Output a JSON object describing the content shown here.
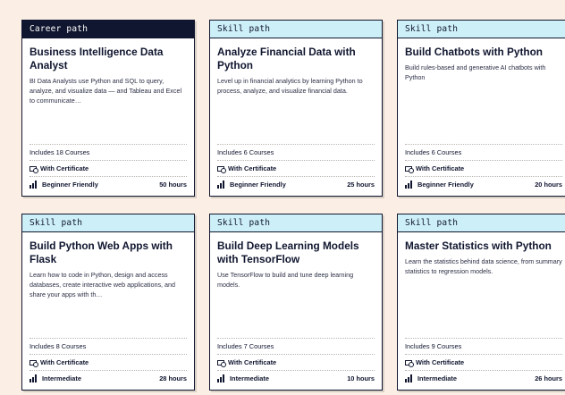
{
  "colors": {
    "page_background": "#fbeee4",
    "career_tag_bg": "#10162f",
    "skill_tag_bg": "#cdeff8",
    "ink": "#10162f"
  },
  "cards": [
    {
      "tag": "Career path",
      "tag_type": "career",
      "title": "Business Intelligence Data Analyst",
      "description": "BI Data Analysts use Python and SQL to query, analyze, and visualize data — and Tableau and Excel to communicate…",
      "courses": "Includes 18 Courses",
      "certificate": "With Certificate",
      "level": "Beginner Friendly",
      "hours": "50 hours"
    },
    {
      "tag": "Skill path",
      "tag_type": "skill",
      "title": "Analyze Financial Data with Python",
      "description": "Level up in financial analytics by learning Python to process, analyze, and visualize financial data.",
      "courses": "Includes 6 Courses",
      "certificate": "With Certificate",
      "level": "Beginner Friendly",
      "hours": "25 hours"
    },
    {
      "tag": "Skill path",
      "tag_type": "skill",
      "title": "Build Chatbots with Python",
      "description": "Build rules-based and generative AI chatbots with Python",
      "courses": "Includes 6 Courses",
      "certificate": "With Certificate",
      "level": "Beginner Friendly",
      "hours": "20 hours"
    },
    {
      "tag": "Skill path",
      "tag_type": "skill",
      "title": "Build Python Web Apps with Flask",
      "description": "Learn how to code in Python, design and access databases, create interactive web applications, and share your apps with th…",
      "courses": "Includes 8 Courses",
      "certificate": "With Certificate",
      "level": "Intermediate",
      "hours": "28 hours"
    },
    {
      "tag": "Skill path",
      "tag_type": "skill",
      "title": "Build Deep Learning Models with TensorFlow",
      "description": "Use TensorFlow to build and tune deep learning models.",
      "courses": "Includes 7 Courses",
      "certificate": "With Certificate",
      "level": "Intermediate",
      "hours": "10 hours"
    },
    {
      "tag": "Skill path",
      "tag_type": "skill",
      "title": "Master Statistics with Python",
      "description": "Learn the statistics behind data science, from summary statistics to regression models.",
      "courses": "Includes 9 Courses",
      "certificate": "With Certificate",
      "level": "Intermediate",
      "hours": "26 hours"
    }
  ]
}
